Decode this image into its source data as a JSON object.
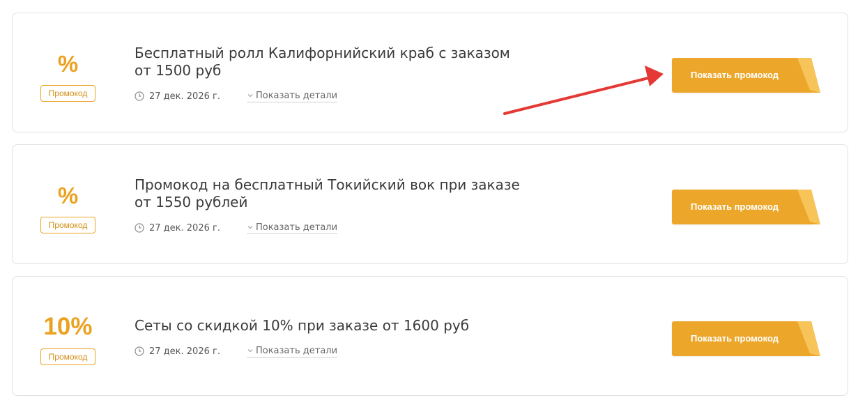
{
  "colors": {
    "accent": "#eba221",
    "button": "#eca72b",
    "button_fold": "#f7c45a",
    "arrow": "#e53935"
  },
  "coupons": [
    {
      "discount": "%",
      "badge": "Промокод",
      "title": "Бесплатный ролл Калифорнийский краб с заказом от 1500 руб",
      "date": "27 дек. 2026 г.",
      "details_label": "Показать детали",
      "button_label": "Показать промокод"
    },
    {
      "discount": "%",
      "badge": "Промокод",
      "title": "Промокод на бесплатный Токийский вок при заказе от 1550 рублей",
      "date": "27 дек. 2026 г.",
      "details_label": "Показать детали",
      "button_label": "Показать промокод"
    },
    {
      "discount": "10%",
      "badge": "Промокод",
      "title": "Сеты со скидкой 10% при заказе от 1600 руб",
      "date": "27 дек. 2026 г.",
      "details_label": "Показать детали",
      "button_label": "Показать промокод"
    }
  ],
  "annotation": {
    "type": "arrow",
    "icon": "red-arrow-icon",
    "points_to": "show-promo-code-button"
  }
}
